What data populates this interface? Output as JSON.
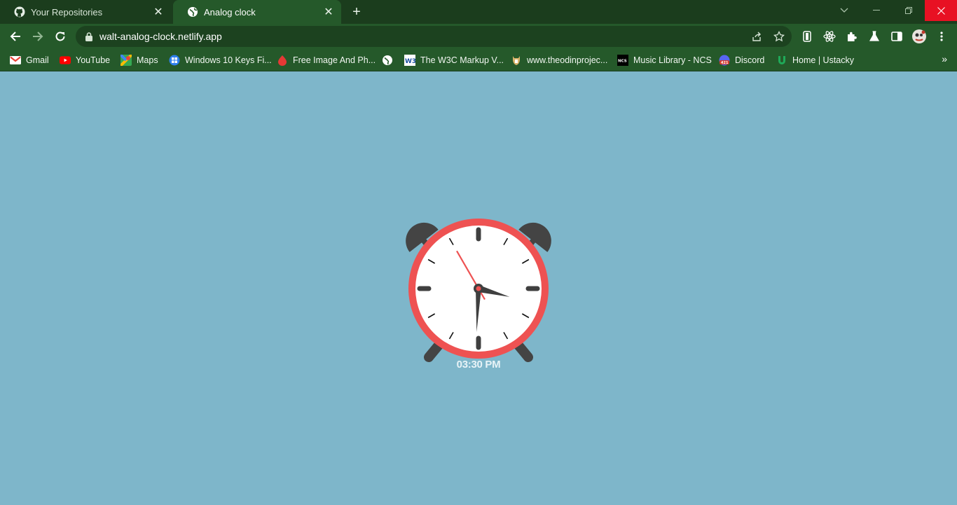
{
  "browser": {
    "tabs": [
      {
        "title": "Your Repositories",
        "icon": "github-icon",
        "active": false
      },
      {
        "title": "Analog clock",
        "icon": "globe-icon",
        "active": true
      }
    ],
    "address": "walt-analog-clock.netlify.app",
    "bookmarks": [
      {
        "label": "Gmail",
        "icon": "gmail-icon",
        "color": "#ea4335"
      },
      {
        "label": "YouTube",
        "icon": "youtube-icon",
        "color": "#ff0000"
      },
      {
        "label": "Maps",
        "icon": "maps-icon",
        "color": "#34a853"
      },
      {
        "label": "Windows 10 Keys Fi...",
        "icon": "windows-icon",
        "color": "#2f80ed"
      },
      {
        "label": "Free Image And Ph...",
        "icon": "image-icon",
        "color": "#e53935"
      },
      {
        "label": "",
        "icon": "globe-icon",
        "color": "#ffffff"
      },
      {
        "label": "The W3C Markup V...",
        "icon": "w3c-icon",
        "color": "#1a4fa0"
      },
      {
        "label": "www.theodinprojec...",
        "icon": "odin-icon",
        "color": "#d9b36b"
      },
      {
        "label": "Music Library - NCS",
        "icon": "ncs-icon",
        "color": "#000000"
      },
      {
        "label": "Discord",
        "icon": "discord-icon",
        "color": "#d33a2c"
      },
      {
        "label": "Home | Ustacky",
        "icon": "ustacky-icon",
        "color": "#1faa59"
      }
    ]
  },
  "clock": {
    "hour": 3,
    "minute": 30,
    "second": 25,
    "display": "03:30 PM",
    "colors": {
      "rim": "#ee5252",
      "face": "#ffffff",
      "hands": "#3f3f3f",
      "second_hand": "#ee5252",
      "bells": "#444444"
    }
  }
}
